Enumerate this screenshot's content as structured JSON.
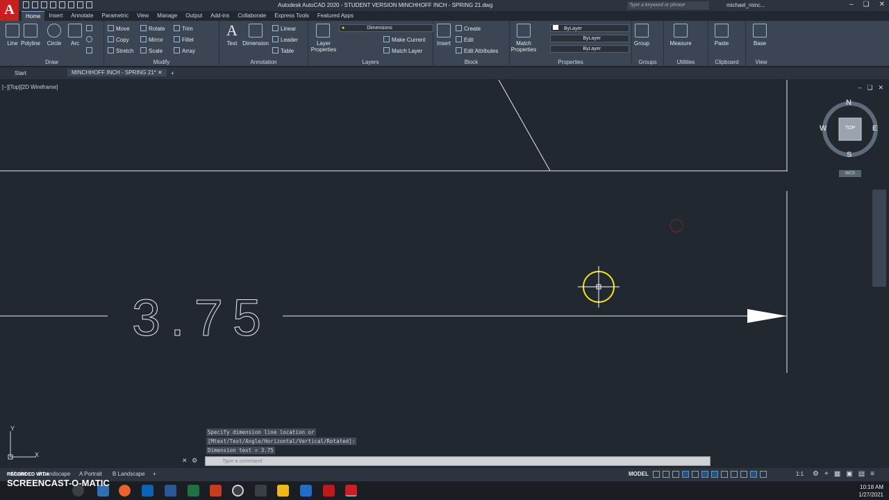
{
  "app": {
    "logo": "A",
    "title": "Autodesk AutoCAD 2020 - STUDENT VERSION    MINCHHOFF INCH - SPRING 21.dwg",
    "search_placeholder": "Type a keyword or phrase",
    "user": "michael_minc..."
  },
  "ribbon": {
    "tabs": [
      "Home",
      "Insert",
      "Annotate",
      "Parametric",
      "View",
      "Manage",
      "Output",
      "Add-ins",
      "Collaborate",
      "Express Tools",
      "Featured Apps"
    ],
    "active_tab": "Home",
    "draw": {
      "title": "Draw",
      "line": "Line",
      "polyline": "Polyline",
      "circle": "Circle",
      "arc": "Arc"
    },
    "modify": {
      "title": "Modify",
      "move": "Move",
      "rotate": "Rotate",
      "trim": "Trim",
      "copy": "Copy",
      "mirror": "Mirror",
      "fillet": "Fillet",
      "stretch": "Stretch",
      "scale": "Scale",
      "array": "Array"
    },
    "annotation": {
      "title": "Annotation",
      "text": "Text",
      "dimension": "Dimension",
      "linear": "Linear",
      "leader": "Leader",
      "table": "Table"
    },
    "layers": {
      "title": "Layers",
      "layer_properties": "Layer Properties",
      "current_layer": "Dimensions",
      "make_current": "Make Current",
      "match_layer": "Match Layer"
    },
    "block": {
      "title": "Block",
      "insert": "Insert",
      "create": "Create",
      "edit": "Edit",
      "edit_attributes": "Edit Attributes"
    },
    "properties": {
      "title": "Properties",
      "match_properties": "Match Properties",
      "color": "ByLayer",
      "lineweight": "ByLayer",
      "linetype": "ByLayer"
    },
    "groups": {
      "title": "Groups",
      "group": "Group"
    },
    "utilities": {
      "title": "Utilities",
      "measure": "Measure"
    },
    "clipboard": {
      "title": "Clipboard",
      "paste": "Paste"
    },
    "view": {
      "title": "View",
      "base": "Base"
    }
  },
  "file_tabs": {
    "start": "Start",
    "drawing": "MINCHHOFF INCH - SPRING 21*"
  },
  "viewport": {
    "label": "[−][Top][2D Wireframe]",
    "compass": {
      "n": "N",
      "s": "S",
      "e": "E",
      "w": "W",
      "top": "TOP"
    },
    "wcs": "WCS",
    "dimension_text": "3.75"
  },
  "command": {
    "history": [
      "Specify dimension line location or",
      "[Mtext/Text/Angle/Horizontal/Vertical/Rotated]:",
      "Dimension text = 3.75"
    ],
    "placeholder": "Type a command"
  },
  "ucs": {
    "x": "X",
    "y": "Y"
  },
  "status": {
    "layouts": [
      "Model",
      "A Landscape",
      "A Portrait",
      "B Landscape"
    ],
    "model": "MODEL",
    "scale": "1:1"
  },
  "taskbar": {
    "time": "10:18 AM",
    "date": "1/27/2021"
  },
  "watermark": {
    "line1": "RECORDED WITH",
    "line2": "SCREENCAST-O-MATIC"
  },
  "colors": {
    "autocad_red": "#c8201f",
    "canvas": "#212830",
    "ribbon": "#3b4554",
    "cursor": "#f2e51b"
  }
}
